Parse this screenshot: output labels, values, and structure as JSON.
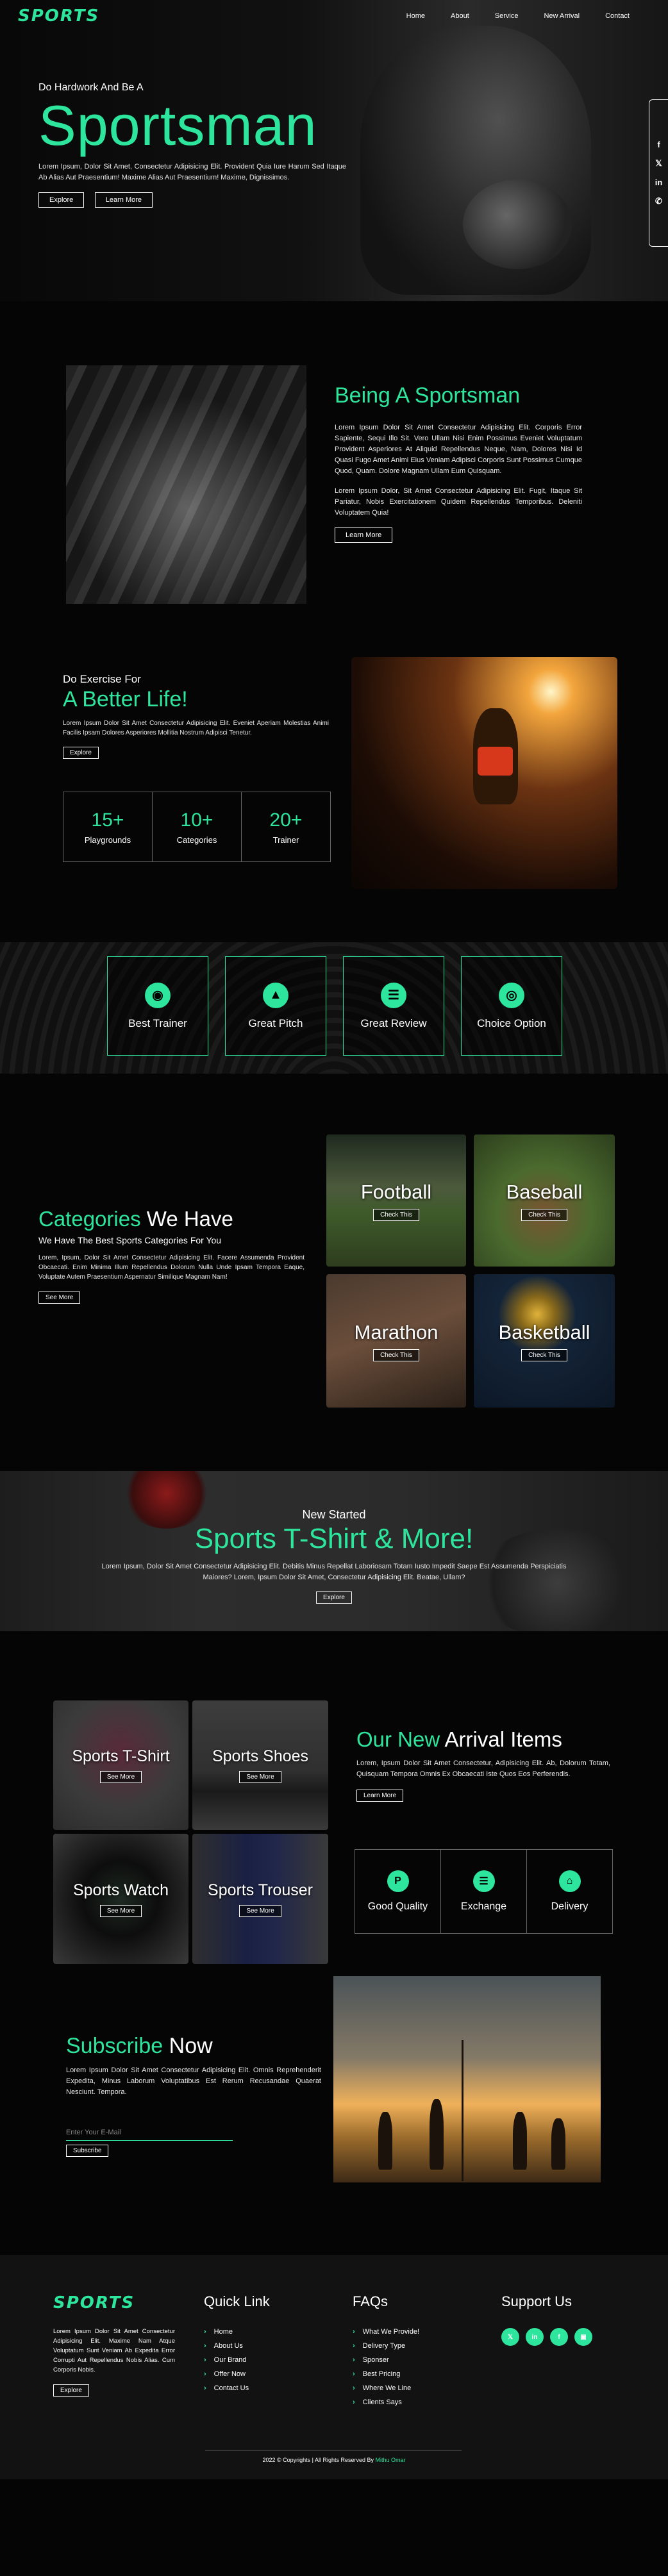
{
  "nav": {
    "logo": "SPORTS",
    "links": [
      "Home",
      "About",
      "Service",
      "New Arrival",
      "Contact"
    ]
  },
  "hero": {
    "pre": "Do Hardwork And Be A",
    "title": "Sportsman",
    "text": "Lorem Ipsum, Dolor Sit Amet, Consectetur Adipisicing Elit. Provident Quia Iure Harum Sed Itaque Ab Alias Aut Praesentium! Maxime Alias Aut Praesentium! Maxime, Dignissimos.",
    "btn_explore": "Explore",
    "btn_learn": "Learn More",
    "social_icons": [
      "facebook-icon",
      "twitter-icon",
      "linkedin-icon",
      "whatsapp-icon"
    ]
  },
  "about": {
    "title_accent": "Being A Sportsman",
    "p1": "Lorem Ipsum Dolor Sit Amet Consectetur Adipisicing Elit. Corporis Error Sapiente, Sequi Illo Sit. Vero Ullam Nisi Enim Possimus Eveniet Voluptatum Provident Asperiores At Aliquid Repellendus Neque, Nam, Dolores Nisi Id Quasi Fugo Amet Animi Eius Veniam Adipisci Corporis Sunt Possimus Cumque Quod, Quam. Dolore Magnam Ullam Eum Quisquam.",
    "p2": "Lorem Ipsum Dolor, Sit Amet Consectetur Adipisicing Elit. Fugit, Itaque Sit Pariatur, Nobis Exercitationem Quidem Repellendus Temporibus. Deleniti Voluptatem Quia!",
    "btn": "Learn More"
  },
  "exercise": {
    "pre": "Do Exercise For",
    "title": "A Better Life!",
    "text": "Lorem Ipsum Dolor Sit Amet Consectetur Adipisicing Elit. Eveniet Aperiam Molestias Animi Facilis Ipsam Dolores Asperiores Mollitia Nostrum Adipisci Tenetur.",
    "btn": "Explore",
    "stats": [
      {
        "value": "15+",
        "label": "Playgrounds"
      },
      {
        "value": "10+",
        "label": "Categories"
      },
      {
        "value": "20+",
        "label": "Trainer"
      }
    ]
  },
  "features": [
    {
      "label": "Best Trainer",
      "icon": "eye-icon"
    },
    {
      "label": "Great Pitch",
      "icon": "campfire-icon"
    },
    {
      "label": "Great Review",
      "icon": "layers-icon"
    },
    {
      "label": "Choice Option",
      "icon": "tennis-ball-icon"
    }
  ],
  "categories": {
    "title_accent": "Categories",
    "title_rest": " We Have",
    "subtitle": "We Have The Best Sports Categories For You",
    "text": "Lorem, Ipsum, Dolor Sit Amet Consectetur Adipisicing Elit. Facere Assumenda Provident Obcaecati. Enim Minima Illum Repellendus Dolorum Nulla Unde Ipsam Tempora Eaque, Voluptate Autem Praesentium Aspernatur Similique Magnam Nam!",
    "btn": "See More",
    "cards": [
      {
        "name": "Football",
        "btn": "Check This"
      },
      {
        "name": "Baseball",
        "btn": "Check This"
      },
      {
        "name": "Marathon",
        "btn": "Check This"
      },
      {
        "name": "Basketball",
        "btn": "Check This"
      }
    ]
  },
  "banner": {
    "pre": "New Started",
    "title": "Sports T-Shirt & More!",
    "text": "Lorem Ipsum, Dolor Sit Amet Consectetur Adipisicing Elit. Debitis Minus Repellat Laboriosam Totam Iusto Impedit Saepe Est Assumenda Perspiciatis Maiores? Lorem, Ipsum Dolor Sit Amet, Consectetur Adipisicing Elit. Beatae, Ullam?",
    "btn": "Explore"
  },
  "arrival": {
    "products": [
      {
        "name": "Sports T-Shirt",
        "btn": "See More"
      },
      {
        "name": "Sports Shoes",
        "btn": "See More"
      },
      {
        "name": "Sports Watch",
        "btn": "See More"
      },
      {
        "name": "Sports Trouser",
        "btn": "See More"
      }
    ],
    "title_accent": "Our New",
    "title_rest": " Arrival Items",
    "text": "Lorem, Ipsum Dolor Sit Amet Consectetur, Adipisicing Elit. Ab, Dolorum Totam, Quisquam Tempora Omnis Ex Obcaecati Iste Quos Eos Perferendis.",
    "btn": "Learn More",
    "features": [
      {
        "label": "Good Quality",
        "icon": "parking-icon"
      },
      {
        "label": "Exchange",
        "icon": "list-icon"
      },
      {
        "label": "Delivery",
        "icon": "home-icon"
      }
    ]
  },
  "subscribe": {
    "title_accent": "Subscribe",
    "title_rest": " Now",
    "text": "Lorem Ipsum Dolor Sit Amet Consectetur Adipisicing Elit. Omnis Reprehenderit Expedita, Minus Laborum Voluptatibus Est Rerum Recusandae Quaerat Nesciunt. Tempora.",
    "placeholder": "Enter Your E-Mail",
    "btn": "Subscribe"
  },
  "footer": {
    "logo": "SPORTS",
    "about": "Lorem Ipsum Dolor Sit Amet Consectetur Adipisicing Elit. Maxime Nam Atque Voluptatum Sunt Veniam Ab Expedita Error Corrupti Aut Repellendus Nobis Alias. Cum Corporis Nobis.",
    "btn": "Explore",
    "quick_title": "Quick Link",
    "quick_links": [
      "Home",
      "About Us",
      "Our Brand",
      "Offer Now",
      "Contact Us"
    ],
    "faq_title": "FAQs",
    "faq_links": [
      "What We Provide!",
      "Delivery Type",
      "Sponser",
      "Best Pricing",
      "Where We Line",
      "Clients Says"
    ],
    "support_title": "Support Us",
    "support_icons": [
      "twitter-icon",
      "linkedin-icon",
      "facebook-icon",
      "instagram-icon"
    ],
    "copyright": "2022 © Copyrights | All Rights Reserved By ",
    "author": "Mithu Omar"
  },
  "colors": {
    "accent": "#2ee59d",
    "background": "#050505",
    "footer": "#121212"
  }
}
